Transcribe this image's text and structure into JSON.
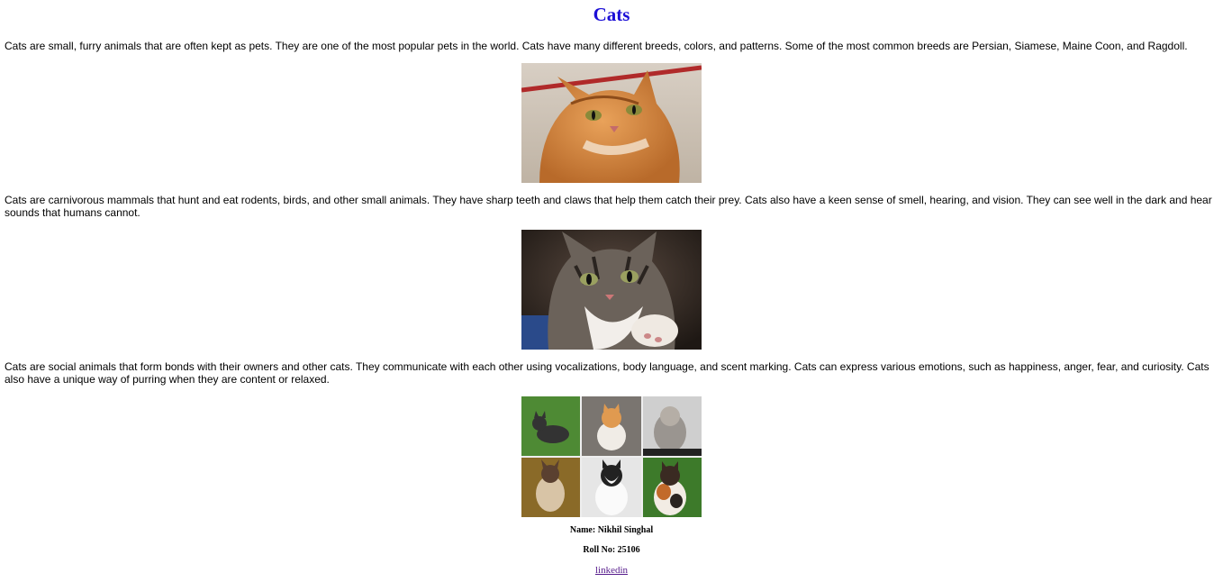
{
  "page": {
    "title": "Cats"
  },
  "paragraphs": [
    "Cats are small, furry animals that are often kept as pets. They are one of the most popular pets in the world. Cats have many different breeds, colors, and patterns. Some of the most common breeds are Persian, Siamese, Maine Coon, and Ragdoll.",
    "Cats are carnivorous mammals that hunt and eat rodents, birds, and other small animals. They have sharp teeth and claws that help them catch their prey. Cats also have a keen sense of smell, hearing, and vision. They can see well in the dark and hear sounds that humans cannot.",
    "Cats are social animals that form bonds with their owners and other cats. They communicate with each other using vocalizations, body language, and scent marking. Cats can express various emotions, such as happiness, anger, fear, and curiosity. Cats also have a unique way of purring when they are content or relaxed."
  ],
  "images": [
    {
      "subject": "orange-tabby-cat"
    },
    {
      "subject": "tabby-cat-reaching-paw"
    },
    {
      "subject": "cat-breeds-collage"
    }
  ],
  "footer": {
    "name_line": "Name: Nikhil Singhal",
    "roll_line": "Roll No: 25106",
    "link_text": "linkedin"
  }
}
